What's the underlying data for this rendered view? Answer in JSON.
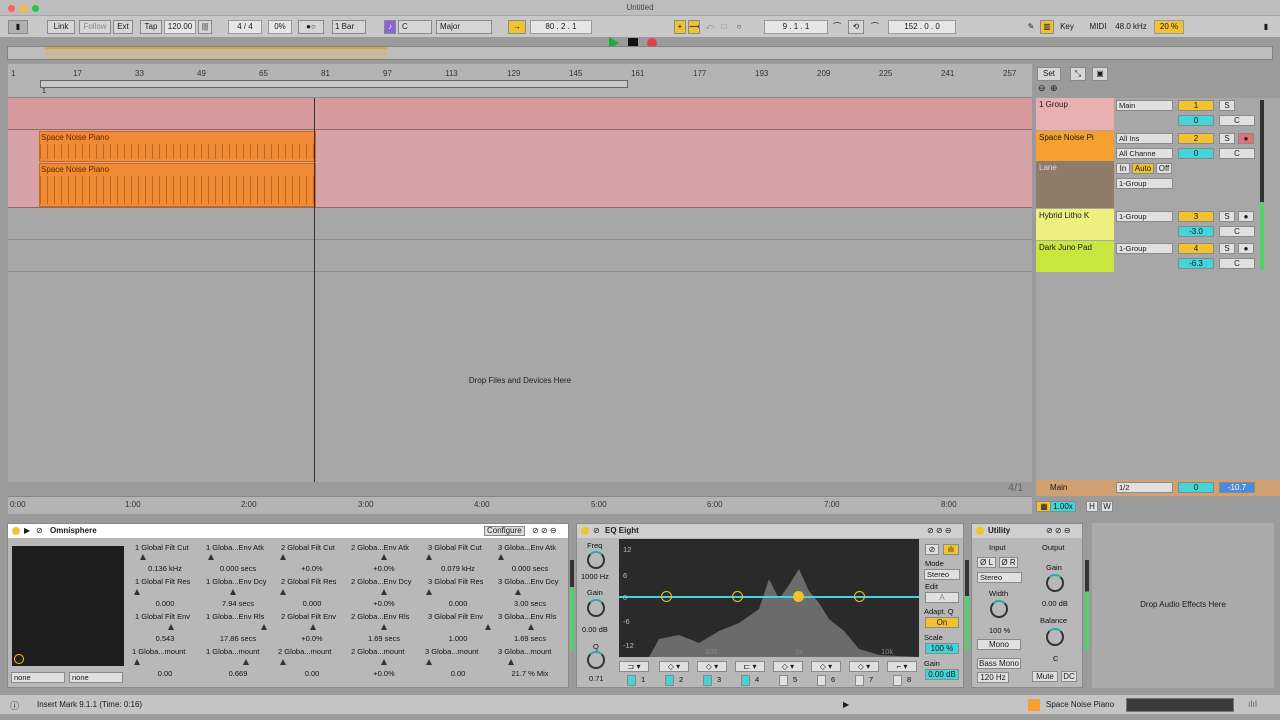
{
  "window": {
    "title": "Untitled"
  },
  "control_bar": {
    "link": "Link",
    "follow": "Follow",
    "ext": "Ext",
    "tap": "Tap",
    "tempo": "120.00",
    "meter": "4 / 4",
    "swing": "0%",
    "metro": "1 Bar",
    "key": "C",
    "scale": "Major",
    "position": "80 .   2 .   1",
    "loop_start": "9 .   1 .   1",
    "loop_length": "152 .   0 .   0",
    "key_map": "Key",
    "midi_map": "MIDI",
    "sample_rate": "48.0 kHz",
    "cpu": "20 %"
  },
  "ruler": {
    "ticks": [
      "1",
      "17",
      "33",
      "49",
      "65",
      "81",
      "97",
      "113",
      "129",
      "145",
      "161",
      "177",
      "193",
      "209",
      "225",
      "241",
      "257"
    ],
    "loop_marker": "1",
    "set_button": "Set"
  },
  "arrangement": {
    "clips": [
      {
        "name": "Space Noise Piano"
      },
      {
        "name": "Space Noise Piano"
      }
    ],
    "drop_hint": "Drop Files and Devices Here"
  },
  "tracks": [
    {
      "name": "1 Group",
      "output": "Main",
      "number": "1",
      "volume": "0",
      "pan": "C",
      "color": "#e8b0b0"
    },
    {
      "name": "Space Noise Pi",
      "input": "All Ins",
      "channel": "All Channe",
      "monitor": [
        "In",
        "Auto",
        "Off"
      ],
      "output": "1-Group",
      "number": "2",
      "volume": "0",
      "pan": "C",
      "lane": "Lane",
      "color": "#f5a030"
    },
    {
      "name": "Hybrid Litho K",
      "output": "1-Group",
      "number": "3",
      "volume": "-3.0",
      "pan": "C",
      "color": "#efef80"
    },
    {
      "name": "Dark Juno Pad",
      "output": "1-Group",
      "number": "4",
      "volume": "-6.3",
      "pan": "C",
      "color": "#c9e640"
    }
  ],
  "main_track": {
    "name": "Main",
    "cue": "1/2",
    "volume": "0",
    "meter": "-10.7",
    "zoom": "1.00x",
    "h": "H",
    "w": "W",
    "time_sig": "4/1"
  },
  "timeline": {
    "ticks": [
      "0:00",
      "1:00",
      "2:00",
      "3:00",
      "4:00",
      "5:00",
      "6:00",
      "7:00",
      "8:00"
    ]
  },
  "omnisphere": {
    "title": "Omnisphere",
    "configure": "Configure",
    "params": [
      [
        "1 Global Filt Cut",
        "1 Globa...Env Atk",
        "2 Global Filt Cut",
        "2 Globa...Env Atk",
        "3 Global Filt Cut",
        "3 Globa...Env Atk"
      ],
      [
        "0.136 kHz",
        "0.000 secs",
        "+0.0%",
        "+0.0%",
        "0.079 kHz",
        "0.000 secs"
      ],
      [
        "1 Global Filt Res",
        "1 Globa...Env Dcy",
        "2 Global Filt Res",
        "2 Globa...Env Dcy",
        "3 Global Filt Res",
        "3 Globa...Env Dcy"
      ],
      [
        "0.000",
        "7.94 secs",
        "0.000",
        "+0.0%",
        "0.000",
        "3.00 secs"
      ],
      [
        "1 Global Filt Env",
        "1 Globa...Env Rls",
        "2 Global Filt Env",
        "2 Globa...Env Rls",
        "3 Global Filt Env",
        "3 Globa...Env Rls"
      ],
      [
        "0.543",
        "17.86 secs",
        "+0.0%",
        "1.69 secs",
        "1.000",
        "1.69 secs"
      ],
      [
        "1 Globa...mount",
        "1 Globa...mount",
        "2 Globa...mount",
        "2 Globa...mount",
        "3 Globa...mount",
        "3 Globa...mount"
      ],
      [
        "0.00",
        "0.669",
        "0.00",
        "+0.0%",
        "0.00",
        "21.7 % Mix"
      ]
    ],
    "select_a": "none",
    "select_b": "none"
  },
  "eq_eight": {
    "title": "EQ Eight",
    "freq_label": "Freq",
    "freq_value": "1000 Hz",
    "gain_label": "Gain",
    "gain_value": "0.00 dB",
    "q_label": "Q",
    "q_value": "0.71",
    "db_labels": [
      "12",
      "6",
      "0",
      "-6",
      "-12"
    ],
    "freq_axis": [
      "100",
      "1k",
      "10k"
    ],
    "mode_label": "Mode",
    "mode_value": "Stereo",
    "edit_label": "Edit",
    "edit_value": "A",
    "adaptq_label": "Adapt. Q",
    "adaptq_value": "On",
    "scale_label": "Scale",
    "scale_value": "100 %",
    "out_gain_label": "Gain",
    "out_gain_value": "0.00 dB",
    "bands": [
      "1",
      "2",
      "3",
      "4",
      "5",
      "6",
      "7",
      "8"
    ]
  },
  "utility": {
    "title": "Utility",
    "input": "Input",
    "output": "Output",
    "left": "Ø L",
    "right": "Ø R",
    "channel": "Stereo",
    "width_label": "Width",
    "width_value": "100 %",
    "mono": "Mono",
    "bass_mono": "Bass Mono",
    "bass_freq": "120 Hz",
    "gain_label": "Gain",
    "gain_value": "0.00 dB",
    "balance_label": "Balance",
    "balance_value": "C",
    "mute": "Mute",
    "dc": "DC"
  },
  "drop_effects": "Drop Audio Effects Here",
  "status": {
    "message": "Insert Mark 9.1.1 (Time: 0:16)",
    "selected_track": "Space Noise Piano"
  },
  "colors": {
    "accent": "#f2c230",
    "clip": "#f18a34",
    "group_bg": "#d69a9c",
    "cyan": "#41d4d8"
  }
}
